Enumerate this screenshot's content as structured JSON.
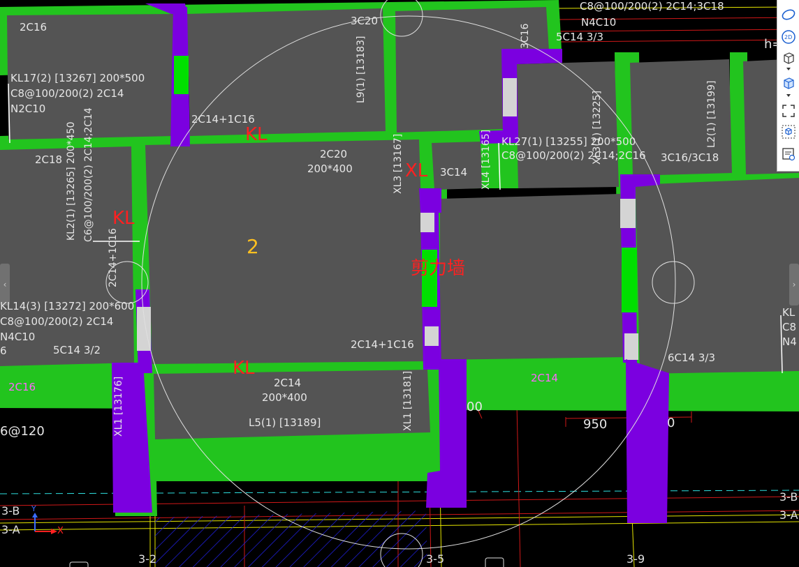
{
  "beam_labels": {
    "b1": "2C16",
    "b2": "KL17(2) [13267] 200*500",
    "b3": "C8@100/200(2) 2C14",
    "b4": "N2C10",
    "b5": "3C20",
    "b6": "2C14+1C16",
    "b7": "2C18",
    "b8": "2C20",
    "b9": "200*400",
    "b10": "3C14",
    "b11": "KL27(1) [13255] 200*500",
    "b12": "C8@100/200(2) 2C14;2C16",
    "b13": "3C16/3C18",
    "b14": "KL14(3) [13272] 200*600",
    "b15": "C8@100/200(2) 2C14",
    "b16": "N4C10",
    "b17": "6",
    "b18": "5C14 3/2",
    "b19": "2C14+1C16",
    "b20": "6C14 3/3",
    "b21": "2C14",
    "b22": "200*400",
    "b23": "L5(1) [13189]",
    "b24": "C8@100/200(2) 2C14;3C18",
    "b25": "N4C10",
    "b26": "5C14 3/3",
    "b27": "6@120",
    "b28": "950",
    "b29": "00",
    "b30": "0",
    "b31": "KL",
    "b32": "C8",
    "b33": "N4",
    "b34": "h="
  },
  "vertical_labels": {
    "v1": "L9(1) [13183]",
    "v2": "3C16",
    "v3": "KL2(1) [13265] 200*450",
    "v4": "C6@100/200(2) 2C14;2C14",
    "v5": "2C14+1C16",
    "v6": "XL3 [13167]",
    "v7": "XL4 [13165]",
    "v8": "XL3(1) [13225]",
    "v9": "L2(1) [13199]",
    "v10": "XL1 [13176]",
    "v11": "XL1 [13181]"
  },
  "markers": {
    "kl1": "KL",
    "kl2": "KL",
    "kl3": "KL",
    "xl": "XL",
    "shear_wall": "剪力墙",
    "slab_no": "2"
  },
  "pink_labels": {
    "p1": "2C16",
    "p2": "2C14"
  },
  "axis_labels": {
    "a1": "3-B",
    "a2": "3-A",
    "a3": "3-2",
    "a4": "3-5",
    "a5": "3-9",
    "a6": "3-B",
    "a7": "3-A",
    "ucs_x": "X",
    "ucs_y": "Y"
  },
  "toolbar": {
    "items": [
      "orbit-icon",
      "2d-view-icon",
      "3d-box-icon",
      "3d-box-solid-icon",
      "fullscreen-icon",
      "view-cube-icon",
      "properties-icon"
    ],
    "label_2d": "2D"
  },
  "colors": {
    "beam": "#22c41e",
    "slab": "#545454",
    "wall": "#7b00e0",
    "wall_green": "#00e000",
    "wall_gray": "#d4d4d4",
    "axis_red": "#d01818",
    "dim_yellow": "#e6e600"
  }
}
